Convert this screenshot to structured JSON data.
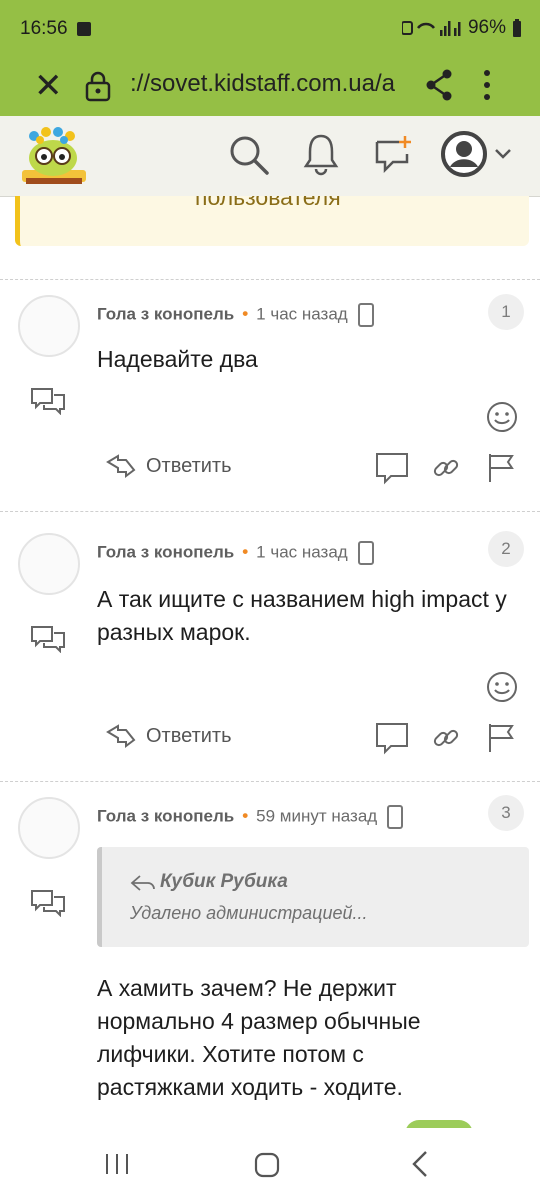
{
  "status_bar": {
    "time": "16:56",
    "battery": "96%"
  },
  "browser": {
    "url": "://sovet.kidstaff.com.ua/a"
  },
  "notice": {
    "text": "пользователя"
  },
  "comments": [
    {
      "author": "Гола з конопель",
      "time": "1 час назад",
      "number": "1",
      "text": "Надевайте два",
      "reply_label": "Ответить"
    },
    {
      "author": "Гола з конопель",
      "time": "1 час назад",
      "number": "2",
      "text": "А так ищите с названием high impact у разных марок.",
      "reply_label": "Ответить"
    },
    {
      "author": "Гола з конопель",
      "time": "59 минут назад",
      "number": "3",
      "quote": {
        "author": "Кубик Рубика",
        "text": "Удалено администрацией..."
      },
      "text": "А хамить зачем? Не держит нормально 4 размер обычные лифчики. Хотите потом с растяжками ходить - ходите."
    }
  ],
  "colors": {
    "brand_green": "#95bf45",
    "accent_orange": "#f08a24"
  }
}
